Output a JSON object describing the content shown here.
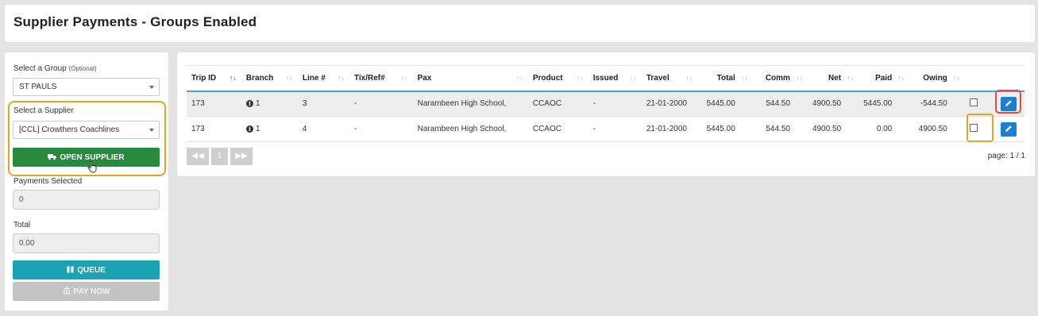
{
  "page": {
    "title": "Supplier Payments - Groups Enabled"
  },
  "left_panel": {
    "group_label": "Select a Group",
    "group_optional": "(Optional)",
    "group_value": "ST PAULS",
    "supplier_label": "Select a Supplier",
    "supplier_value": "[CCL] Crowthers Coachlines",
    "open_supplier_label": "OPEN SUPPLIER",
    "payments_selected_label": "Payments Selected",
    "payments_selected_value": "0",
    "total_label": "Total",
    "total_value": "0.00",
    "queue_label": "QUEUE",
    "pay_now_label": "PAY NOW"
  },
  "table": {
    "columns": [
      "Trip ID",
      "Branch",
      "Line #",
      "Tix/Ref#",
      "Pax",
      "Product",
      "Issued",
      "Travel",
      "Total",
      "Comm",
      "Net",
      "Paid",
      "Owing"
    ],
    "rows": [
      {
        "trip_id": "173",
        "branch": "1",
        "line": "3",
        "tix": "-",
        "pax": "Narambeen High School,",
        "product": "CCAOC",
        "issued": "-",
        "travel": "21-01-2000",
        "total": "5445.00",
        "comm": "544.50",
        "net": "4900.50",
        "paid": "5445.00",
        "owing": "-544.50"
      },
      {
        "trip_id": "173",
        "branch": "1",
        "line": "4",
        "tix": "-",
        "pax": "Narambeen High School,",
        "product": "CCAOC",
        "issued": "-",
        "travel": "21-01-2000",
        "total": "5445.00",
        "comm": "544.50",
        "net": "4900.50",
        "paid": "0.00",
        "owing": "4900.50"
      }
    ]
  },
  "pagination": {
    "current_page": "1",
    "page_info": "page: 1 / 1"
  },
  "icons": {
    "open_supplier": "truck-icon",
    "queue": "pause-icon",
    "pay_now": "bank-icon",
    "first_page": "fast-backward-icon",
    "last_page": "fast-forward-icon",
    "branch_info": "info-circle-icon",
    "edit": "pencil-icon",
    "cursor": "hand-pointer-icon"
  },
  "colors": {
    "open_supplier": "#278a3c",
    "queue": "#1aa3b5",
    "pay_now_disabled": "#c4c4c4",
    "edit_button": "#1a7fd1",
    "header_rule": "#4aa3df",
    "highlight_amber": "#e7a321",
    "highlight_red": "#e34a4a"
  }
}
